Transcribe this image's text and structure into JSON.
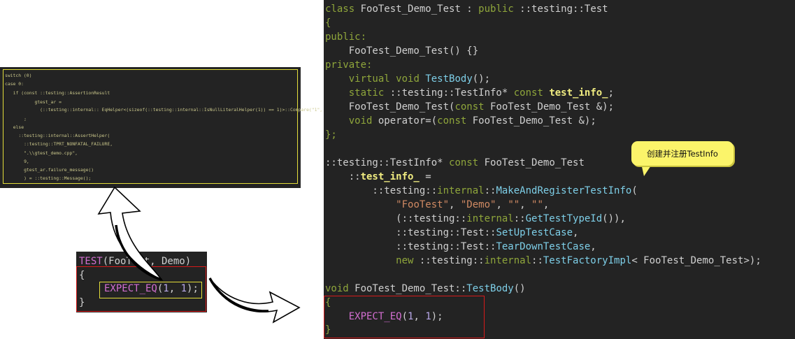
{
  "gtest_expansion": {
    "lines": [
      "switch (0)",
      "case 0:",
      "  if (const ::testing::AssertionResult",
      "          gtest_ar =",
      "            (::testing::internal:: EqHelper<(sizeof(::testing::internal::IsNullLiteralHelper(1)) == 1)>::Compare(\"1\", \"1\", 1, 1)))",
      "      ;",
      "  else",
      "    ::testing::internal::AssertHelper(",
      "      ::testing::TPRT_NONFATAL_FAILURE,",
      "      \".\\\\gtest_demo.cpp\",",
      "      9,",
      "      gtest_ar.failure_message()",
      "      ) = ::testing::Message();"
    ]
  },
  "test_macro": {
    "macro": "TEST",
    "args": "(FooTest, Demo)",
    "open_brace": "{",
    "expect_macro": "EXPECT_EQ",
    "expect_args_open": "(",
    "n1": "1",
    "comma": ", ",
    "n2": "1",
    "expect_close": ");",
    "close_brace": "}"
  },
  "class_def": {
    "kw_class": "class",
    "class_name": " FooTest_Demo_Test : ",
    "kw_public": "public",
    "base_class": " ::testing::Test",
    "open_brace": "{",
    "public_label": "public:",
    "ctor": "    FooTest_Demo_Test() {}",
    "private_label": "private:",
    "kw_virtual": "    virtual ",
    "kw_void": "void ",
    "test_body_fn": "TestBody",
    "test_body_end": "();",
    "kw_static": "    static ",
    "testinfo_ptr": "::testing::TestInfo* ",
    "kw_const": "const ",
    "test_info_member": "test_info_",
    "semicolon": ";",
    "copy_ctor_start": "    FooTest_Demo_Test(",
    "copy_ctor_const": "const",
    "copy_ctor_end": " FooTest_Demo_Test &);",
    "kw_void_indent": "    void ",
    "operator_start": "operator=(",
    "operator_const": "const",
    "operator_end": " FooTest_Demo_Test &);",
    "close_brace": "};"
  },
  "registration": {
    "decl_type": "::testing::TestInfo* ",
    "decl_const": "const",
    "decl_class": " FooTest_Demo_Test",
    "scope": "    ::",
    "member": "test_info_",
    "assign": " =",
    "ns_prefix": "        ::testing::",
    "internal_ns": "internal",
    "scope_sep": "::",
    "make_fn": "MakeAndRegisterTestInfo",
    "make_paren": "(",
    "arg_indent": "            ",
    "str_footest": "\"FooTest\"",
    "str_sep": ", ",
    "str_demo": "\"Demo\"",
    "str_empty1": "\"\"",
    "str_empty2": "\"\"",
    "str_trailing": ",",
    "type_id_prefix": "            (::testing::",
    "get_type_fn": "GetTestTypeId",
    "get_type_end": "()),",
    "test_prefix": "            ::testing::Test::",
    "setup_fn": "SetUpTestCase",
    "teardown_fn": "TearDownTestCase",
    "fn_trailing": ",",
    "kw_new": "            new ",
    "factory_prefix": "::testing::",
    "factory_fn": "TestFactoryImpl",
    "factory_end": "< FooTest_Demo_Test>);"
  },
  "test_body_def": {
    "kw_void": "void",
    "signature": " FooTest_Demo_Test::",
    "fn": "TestBody",
    "paren": "()",
    "open_brace": "{",
    "indent": "    ",
    "expect_macro": "EXPECT_EQ",
    "paren_open": "(",
    "n1": "1",
    "comma": ", ",
    "n2": "1",
    "close": ");",
    "close_brace": "}"
  },
  "callout": {
    "text": "创建并注册TestInfo"
  },
  "colors": {
    "panel_bg": "#232323",
    "highlight_box": "#d61a1a",
    "focus_box": "#e2dd3a",
    "callout_bg": "#fbf46a"
  },
  "icons": [
    "curved-up-arrow-icon",
    "curved-right-arrow-icon"
  ]
}
